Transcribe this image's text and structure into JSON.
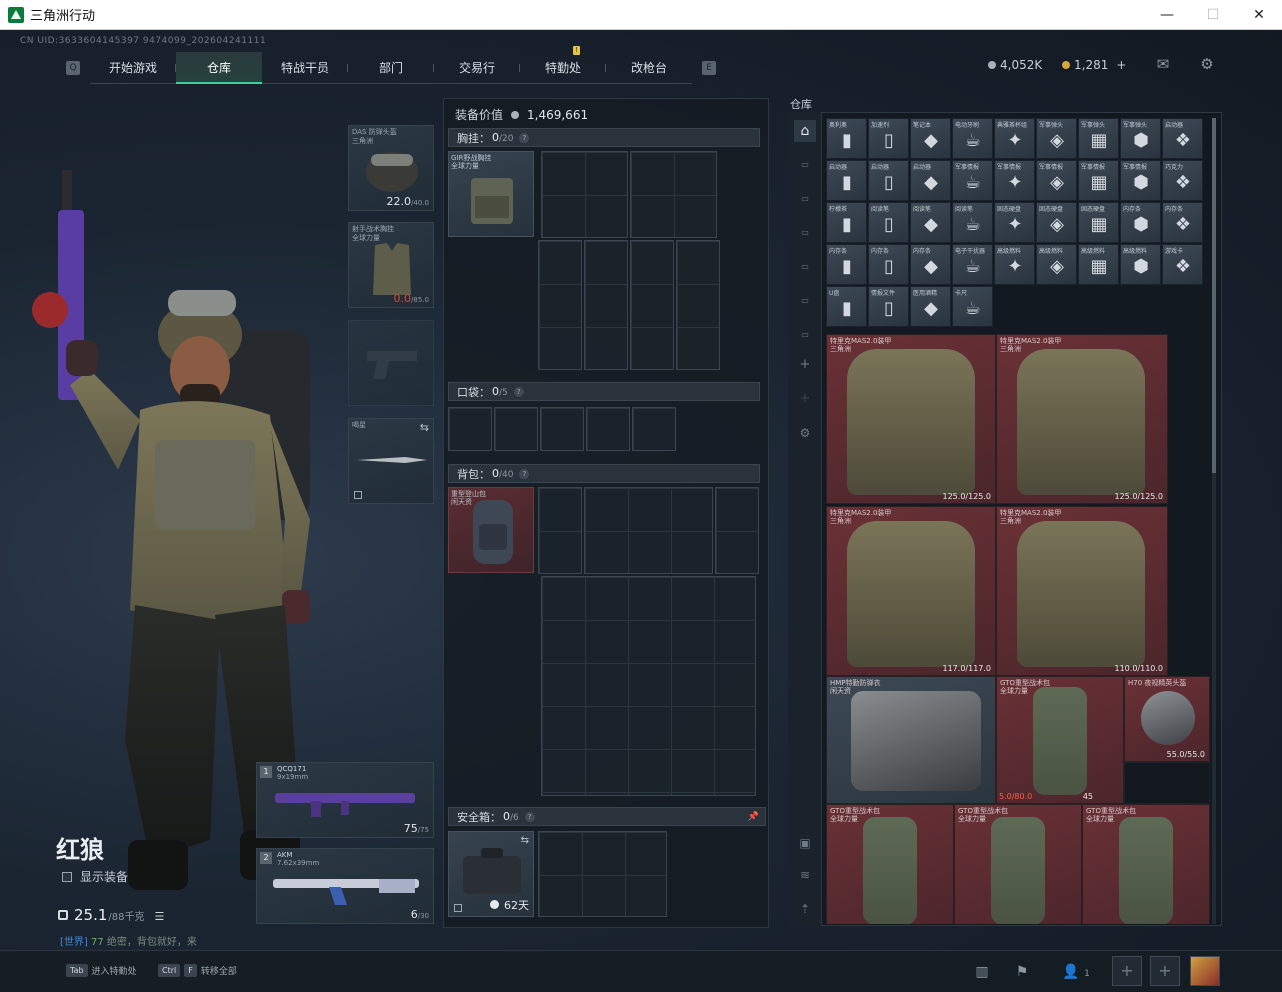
{
  "window": {
    "title": "三角洲行动",
    "minimize": "—",
    "maximize": "☐",
    "close": "✕"
  },
  "uid": "CN UID:3633604145397 9474099_202604241111",
  "nav": {
    "tabs": [
      {
        "label": "开始游戏",
        "active": false
      },
      {
        "label": "仓库",
        "active": true
      },
      {
        "label": "特战干员",
        "active": false
      },
      {
        "label": "部门",
        "active": false
      },
      {
        "label": "交易行",
        "active": false
      },
      {
        "label": "特勤处",
        "active": false,
        "badge": "!"
      },
      {
        "label": "改枪台",
        "active": false
      }
    ],
    "left_key": "Q",
    "right_key": "E"
  },
  "currency": {
    "silver": "4,052K",
    "gold": "1,281",
    "plus": "+"
  },
  "character": {
    "name": "红狼",
    "show_gear": "显示装备",
    "weight": "25.1",
    "weight_max": "/88千克",
    "chat_channel": "[世界]",
    "chat_tag": "77",
    "chat_text": "绝密，背包就好，来"
  },
  "equip": {
    "helmet": {
      "label": "DAS 防弹头盔\n三角洲",
      "dur": "22.0",
      "max": "/40.0"
    },
    "armor": {
      "label": "射手战术胸挂\n全球力量",
      "dur": "0.0",
      "max": "/85.0"
    },
    "melee": {
      "label": "喝星",
      "swap": "⇆"
    },
    "gun1": {
      "slot": "1",
      "name": "QCQ171",
      "caliber": "9x19mm",
      "ammo": "75",
      "ammo_max": "/75"
    },
    "gun2": {
      "slot": "2",
      "name": "AKM",
      "caliber": "7.62x39mm",
      "ammo": "6",
      "ammo_max": "/30"
    }
  },
  "mid": {
    "value_label": "装备价值",
    "value": "1,469,661",
    "chest": {
      "title": "胸挂：",
      "count": "0",
      "max": "/20",
      "item": "GIR野战胸挂\n全球力量"
    },
    "pocket": {
      "title": "口袋：",
      "count": "0",
      "max": "/5"
    },
    "backpack": {
      "title": "背包：",
      "count": "0",
      "max": "/40",
      "item": "重型登山包\n闲天资"
    },
    "safe": {
      "title": "安全箱：",
      "count": "0",
      "max": "/6",
      "time": "62天",
      "pin": "📌"
    }
  },
  "storage": {
    "title": "仓库",
    "small_items": [
      [
        "奥利奥",
        "加速剂",
        "笔记本",
        "电动牙刷",
        "典雅茶杯组",
        "军事弹头",
        "军事弹头",
        "军事弹头",
        "启动器"
      ],
      [
        "启动器",
        "启动器",
        "启动器",
        "军事情报",
        "军事情报",
        "军事情报",
        "军事情报",
        "军事情报",
        "巧克力"
      ],
      [
        "柠檬茶",
        "阅读笔",
        "阅读笔",
        "阅读笔",
        "固态硬盘",
        "固态硬盘",
        "固态硬盘",
        "内存条",
        "内存条"
      ],
      [
        "内存条",
        "内存条",
        "内存条",
        "电子干扰器",
        "高级燃料",
        "高级燃料",
        "高级燃料",
        "高级燃料",
        "游戏卡"
      ],
      [
        "U盘",
        "情报文件",
        "医用酒精",
        "卡尺"
      ]
    ],
    "armor_items": [
      {
        "label": "特里克MAS2.0装甲\n三角洲",
        "dur": "125.0/125.0"
      },
      {
        "label": "特里克MAS2.0装甲\n三角洲",
        "dur": "125.0/125.0"
      },
      {
        "label": "特里克MAS2.0装甲\n三角洲",
        "dur": "117.0/117.0"
      },
      {
        "label": "特里克MAS2.0装甲\n三角洲",
        "dur": "110.0/110.0"
      }
    ],
    "row3": [
      {
        "label": "HMP特勤防弹衣\n闲天资"
      },
      {
        "label": "GTO重型战术包\n全球力量",
        "dur": "5.0/80.0",
        "count": "45"
      },
      {
        "label": "H70 夜视精英头盔",
        "dur": "55.0/55.0"
      }
    ],
    "row4": [
      {
        "label": "GTO重型战术包\n全球力量"
      },
      {
        "label": "GTO重型战术包\n全球力量"
      },
      {
        "label": "GTO重型战术包\n全球力量"
      }
    ]
  },
  "bottom": {
    "tab_key": "Tab",
    "tab_label": "进入特勤处",
    "ctrl_key": "Ctrl",
    "f_key": "F",
    "f_label": "转移全部",
    "players": "1"
  },
  "colors": {
    "accent": "#3bd19a",
    "item_red": "#5b2d33",
    "warn": "#e8c341"
  }
}
